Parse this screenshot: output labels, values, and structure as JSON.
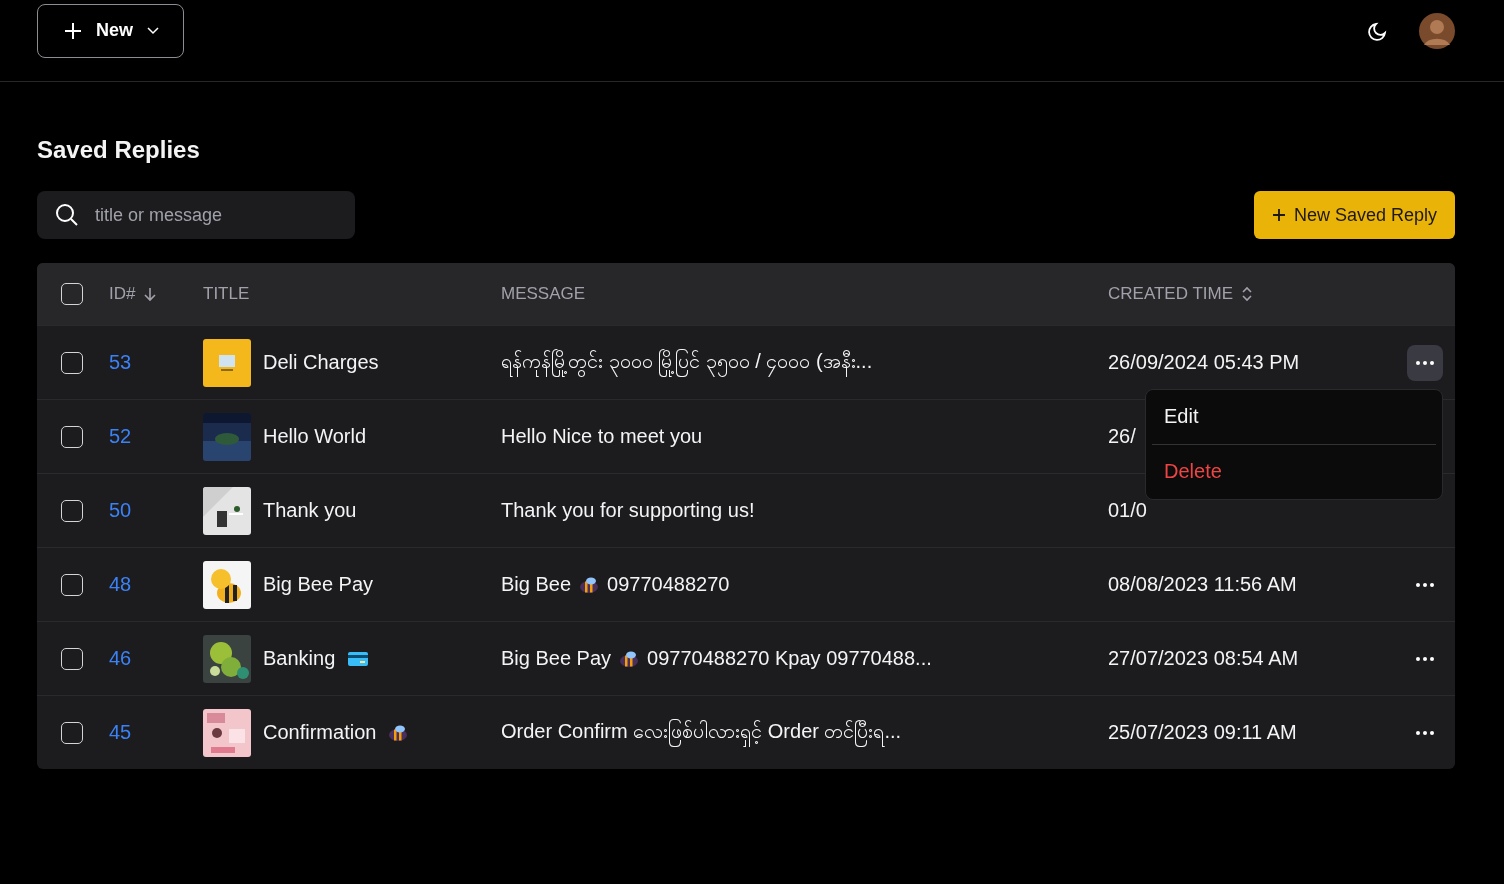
{
  "header": {
    "new_button": "New"
  },
  "page_title": "Saved Replies",
  "search": {
    "placeholder": "title or message"
  },
  "new_reply_button": "New Saved Reply",
  "table": {
    "select_all_checked": false,
    "columns": [
      {
        "label": "ID#",
        "kind": "sorted"
      },
      {
        "label": "TITLE",
        "kind": "plain"
      },
      {
        "label": "MESSAGE",
        "kind": "plain"
      },
      {
        "label": "CREATED TIME",
        "kind": "sortable"
      }
    ],
    "rows": [
      {
        "checked": false,
        "id": "53",
        "title": [
          {
            "kind": "text",
            "text": "Deli Charges"
          }
        ],
        "message": [
          {
            "kind": "text",
            "text": "ရန်ကုန်မြို့တွင်း ၃၀၀၀ မြို့ပြင် ၃၅၀၀ / ၄၀၀၀ (အနီး..."
          }
        ],
        "created": "26/09/2024 05:43 PM",
        "more_button": true,
        "menu_open": true,
        "menu": [
          {
            "label": "Edit",
            "kind": "normal"
          },
          {
            "label": "Delete",
            "kind": "danger"
          }
        ]
      },
      {
        "checked": false,
        "id": "52",
        "title": [
          {
            "kind": "text",
            "text": "Hello World"
          }
        ],
        "message": [
          {
            "kind": "text",
            "text": "Hello Nice to meet you"
          }
        ],
        "created": "26/",
        "more_button": false
      },
      {
        "checked": false,
        "id": "50",
        "title": [
          {
            "kind": "text",
            "text": "Thank you"
          }
        ],
        "message": [
          {
            "kind": "text",
            "text": "Thank you for supporting us!"
          }
        ],
        "created": "01/0",
        "more_button": false
      },
      {
        "checked": false,
        "id": "48",
        "title": [
          {
            "kind": "text",
            "text": "Big Bee Pay"
          }
        ],
        "message": [
          {
            "kind": "text",
            "text": "Big Bee"
          },
          {
            "kind": "bee"
          },
          {
            "kind": "text",
            "text": "09770488270"
          }
        ],
        "created": "08/08/2023 11:56 AM",
        "more_button": true,
        "menu_open": false
      },
      {
        "checked": false,
        "id": "46",
        "title": [
          {
            "kind": "text",
            "text": "Banking"
          },
          {
            "kind": "card"
          }
        ],
        "message": [
          {
            "kind": "text",
            "text": "Big Bee Pay"
          },
          {
            "kind": "bee"
          },
          {
            "kind": "text",
            "text": "09770488270 Kpay 09770488..."
          }
        ],
        "created": "27/07/2023 08:54 AM",
        "more_button": true,
        "menu_open": false
      },
      {
        "checked": false,
        "id": "45",
        "title": [
          {
            "kind": "text",
            "text": "Confirmation"
          },
          {
            "kind": "bee"
          }
        ],
        "message": [
          {
            "kind": "text",
            "text": "Order Confirm လေးဖြစ်ပါလားရှင့် Order တင်ပြီးရ..."
          }
        ],
        "created": "25/07/2023 09:11 AM",
        "more_button": true,
        "menu_open": false
      }
    ]
  }
}
